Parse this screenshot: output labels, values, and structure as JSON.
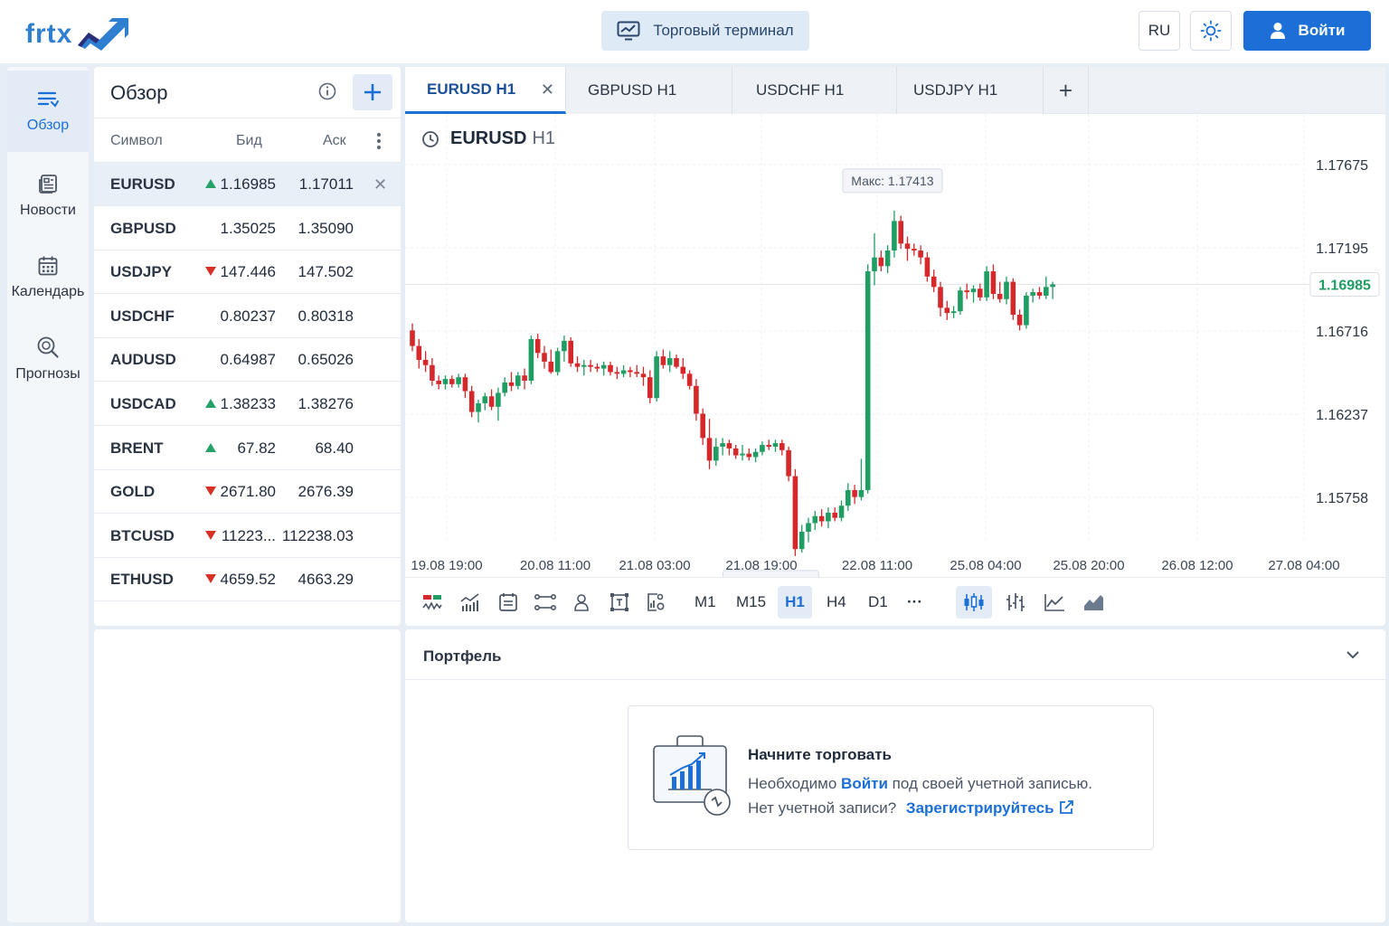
{
  "header": {
    "logo_text": "frtx",
    "terminal_label": "Торговый терминал",
    "lang": "RU",
    "login_label": "Войти",
    "brand_color": "#1b6fd6"
  },
  "nav": {
    "items": [
      {
        "label": "Обзор",
        "icon": "list-icon"
      },
      {
        "label": "Новости",
        "icon": "news-icon"
      },
      {
        "label": "Календарь",
        "icon": "calendar-icon"
      },
      {
        "label": "Прогнозы",
        "icon": "forecast-icon"
      }
    ]
  },
  "overview": {
    "title": "Обзор",
    "columns": {
      "symbol": "Символ",
      "bid": "Бид",
      "ask": "Аск"
    },
    "rows": [
      {
        "symbol": "EURUSD",
        "dir": "up",
        "bid": "1.16985",
        "ask": "1.17011"
      },
      {
        "symbol": "GBPUSD",
        "dir": "",
        "bid": "1.35025",
        "ask": "1.35090"
      },
      {
        "symbol": "USDJPY",
        "dir": "down",
        "bid": "147.446",
        "ask": "147.502"
      },
      {
        "symbol": "USDCHF",
        "dir": "",
        "bid": "0.80237",
        "ask": "0.80318"
      },
      {
        "symbol": "AUDUSD",
        "dir": "",
        "bid": "0.64987",
        "ask": "0.65026"
      },
      {
        "symbol": "USDCAD",
        "dir": "up",
        "bid": "1.38233",
        "ask": "1.38276"
      },
      {
        "symbol": "BRENT",
        "dir": "up",
        "bid": "67.82",
        "ask": "68.40"
      },
      {
        "symbol": "GOLD",
        "dir": "down",
        "bid": "2671.80",
        "ask": "2676.39"
      },
      {
        "symbol": "BTCUSD",
        "dir": "down",
        "bid": "11223...",
        "ask": "112238.03"
      },
      {
        "symbol": "ETHUSD",
        "dir": "down",
        "bid": "4659.52",
        "ask": "4663.29"
      }
    ]
  },
  "tabs": [
    {
      "label": "EURUSD H1",
      "active": true
    },
    {
      "label": "GBPUSD H1"
    },
    {
      "label": "USDCHF H1"
    },
    {
      "label": "USDJPY H1"
    }
  ],
  "chart": {
    "symbol": "EURUSD",
    "timeframe": "H1",
    "y_ticks": [
      "1.17675",
      "1.17195",
      "1.16716",
      "1.16237",
      "1.15758"
    ],
    "current_price": "1.16985",
    "max_label": "Макс: 1.17413",
    "min_label": "Мин: 1.15418",
    "x_ticks": [
      "19.08 19:00",
      "20.08 11:00",
      "21.08 03:00",
      "21.08 19:00",
      "22.08 11:00",
      "25.08 04:00",
      "25.08 20:00",
      "26.08 12:00",
      "27.08 04:00"
    ],
    "up_color": "#1f9d63",
    "down_color": "#d6282b"
  },
  "toolbar": {
    "timeframes": [
      "M1",
      "M15",
      "H1",
      "H4",
      "D1"
    ],
    "active_timeframe": "H1",
    "more": "···"
  },
  "portfolio": {
    "title": "Портфель",
    "card_title": "Начните торговать",
    "line1_prefix": "Необходимо",
    "line1_link": "Войти",
    "line1_suffix": "под своей учетной записью.",
    "line2_prefix": "Нет учетной записи?",
    "line2_link": "Зарегистрируйтесь"
  },
  "chart_data": {
    "type": "candlestick",
    "symbol": "EURUSD",
    "timeframe": "H1",
    "ylim": [
      1.156,
      1.1775
    ],
    "y_ticks": [
      1.17675,
      1.17195,
      1.16716,
      1.16237,
      1.15758
    ],
    "current": 1.16985,
    "max": 1.17413,
    "min": 1.15418,
    "candles": [
      [
        1.1672,
        1.1676,
        1.166,
        1.1663
      ],
      [
        1.1663,
        1.1667,
        1.165,
        1.1655
      ],
      [
        1.1655,
        1.166,
        1.1648,
        1.1652
      ],
      [
        1.1652,
        1.1656,
        1.164,
        1.1643
      ],
      [
        1.1643,
        1.1646,
        1.1638,
        1.1641
      ],
      [
        1.1641,
        1.1646,
        1.1638,
        1.1644
      ],
      [
        1.1644,
        1.1646,
        1.1639,
        1.1641
      ],
      [
        1.1641,
        1.1647,
        1.1639,
        1.1645
      ],
      [
        1.1645,
        1.1647,
        1.1633,
        1.1637
      ],
      [
        1.1637,
        1.164,
        1.1622,
        1.1625
      ],
      [
        1.1625,
        1.1632,
        1.1619,
        1.163
      ],
      [
        1.163,
        1.1636,
        1.1626,
        1.1634
      ],
      [
        1.1634,
        1.1638,
        1.1626,
        1.1628
      ],
      [
        1.1628,
        1.1639,
        1.162,
        1.1636
      ],
      [
        1.1636,
        1.1645,
        1.1634,
        1.1642
      ],
      [
        1.1642,
        1.1648,
        1.1637,
        1.164
      ],
      [
        1.164,
        1.1648,
        1.1638,
        1.1646
      ],
      [
        1.1646,
        1.165,
        1.1638,
        1.1643
      ],
      [
        1.1643,
        1.1669,
        1.1641,
        1.1667
      ],
      [
        1.1667,
        1.167,
        1.1656,
        1.1659
      ],
      [
        1.1659,
        1.1663,
        1.165,
        1.1654
      ],
      [
        1.1654,
        1.1661,
        1.1647,
        1.1648
      ],
      [
        1.1648,
        1.1662,
        1.1646,
        1.166
      ],
      [
        1.166,
        1.1669,
        1.1654,
        1.1666
      ],
      [
        1.1666,
        1.1668,
        1.1651,
        1.1653
      ],
      [
        1.1653,
        1.1657,
        1.1648,
        1.1651
      ],
      [
        1.1651,
        1.1655,
        1.1646,
        1.1652
      ],
      [
        1.1652,
        1.1655,
        1.1648,
        1.1651
      ],
      [
        1.1651,
        1.1653,
        1.1648,
        1.165
      ],
      [
        1.165,
        1.1654,
        1.1646,
        1.1652
      ],
      [
        1.1652,
        1.1654,
        1.1646,
        1.1648
      ],
      [
        1.1648,
        1.1651,
        1.1644,
        1.1647
      ],
      [
        1.1647,
        1.1652,
        1.1645,
        1.1649
      ],
      [
        1.1649,
        1.1651,
        1.1645,
        1.1648
      ],
      [
        1.1648,
        1.1652,
        1.1645,
        1.1647
      ],
      [
        1.1647,
        1.1651,
        1.164,
        1.1645
      ],
      [
        1.1645,
        1.1649,
        1.163,
        1.1633
      ],
      [
        1.1633,
        1.166,
        1.1631,
        1.1657
      ],
      [
        1.1657,
        1.1661,
        1.165,
        1.1652
      ],
      [
        1.1652,
        1.166,
        1.1648,
        1.1656
      ],
      [
        1.1656,
        1.1658,
        1.165,
        1.1651
      ],
      [
        1.1651,
        1.1656,
        1.1644,
        1.1647
      ],
      [
        1.1647,
        1.1649,
        1.1638,
        1.164
      ],
      [
        1.164,
        1.1644,
        1.162,
        1.1624
      ],
      [
        1.1624,
        1.1627,
        1.1606,
        1.161
      ],
      [
        1.161,
        1.1621,
        1.1592,
        1.1597
      ],
      [
        1.1597,
        1.161,
        1.1594,
        1.1605
      ],
      [
        1.1605,
        1.161,
        1.16,
        1.1607
      ],
      [
        1.1607,
        1.1609,
        1.16,
        1.1604
      ],
      [
        1.1604,
        1.1606,
        1.1598,
        1.16
      ],
      [
        1.16,
        1.1606,
        1.1597,
        1.1601
      ],
      [
        1.1601,
        1.1604,
        1.1597,
        1.1599
      ],
      [
        1.1599,
        1.1604,
        1.1596,
        1.1602
      ],
      [
        1.1602,
        1.1608,
        1.16,
        1.1606
      ],
      [
        1.1606,
        1.1609,
        1.1603,
        1.1605
      ],
      [
        1.1605,
        1.1609,
        1.1602,
        1.1607
      ],
      [
        1.1607,
        1.1609,
        1.16,
        1.1603
      ],
      [
        1.1603,
        1.1605,
        1.1585,
        1.1588
      ],
      [
        1.1588,
        1.1592,
        1.1542,
        1.1546
      ],
      [
        1.1546,
        1.156,
        1.1544,
        1.1556
      ],
      [
        1.1556,
        1.1564,
        1.155,
        1.1561
      ],
      [
        1.1561,
        1.1568,
        1.1557,
        1.1565
      ],
      [
        1.1565,
        1.1569,
        1.1559,
        1.1562
      ],
      [
        1.1562,
        1.157,
        1.1558,
        1.1567
      ],
      [
        1.1567,
        1.157,
        1.1562,
        1.1564
      ],
      [
        1.1564,
        1.1574,
        1.1562,
        1.1571
      ],
      [
        1.1571,
        1.1584,
        1.1568,
        1.158
      ],
      [
        1.158,
        1.1583,
        1.1572,
        1.1576
      ],
      [
        1.1576,
        1.1598,
        1.1574,
        1.158
      ],
      [
        1.158,
        1.171,
        1.1578,
        1.1706
      ],
      [
        1.1706,
        1.1728,
        1.1698,
        1.1714
      ],
      [
        1.1714,
        1.1718,
        1.1706,
        1.1709
      ],
      [
        1.1709,
        1.1721,
        1.1705,
        1.1718
      ],
      [
        1.1718,
        1.1741,
        1.1714,
        1.1735
      ],
      [
        1.1735,
        1.1738,
        1.1719,
        1.1722
      ],
      [
        1.1722,
        1.1726,
        1.1712,
        1.1719
      ],
      [
        1.1719,
        1.1722,
        1.1715,
        1.1718
      ],
      [
        1.1718,
        1.1721,
        1.171,
        1.1714
      ],
      [
        1.1714,
        1.1717,
        1.17,
        1.1703
      ],
      [
        1.1703,
        1.1707,
        1.1694,
        1.1697
      ],
      [
        1.1697,
        1.17,
        1.168,
        1.1685
      ],
      [
        1.1685,
        1.1689,
        1.1678,
        1.1682
      ],
      [
        1.1682,
        1.1686,
        1.1679,
        1.1683
      ],
      [
        1.1683,
        1.1697,
        1.1681,
        1.1695
      ],
      [
        1.1695,
        1.1699,
        1.169,
        1.1694
      ],
      [
        1.1694,
        1.1698,
        1.1688,
        1.1696
      ],
      [
        1.1696,
        1.1699,
        1.1689,
        1.1691
      ],
      [
        1.1691,
        1.1709,
        1.1689,
        1.1706
      ],
      [
        1.1706,
        1.171,
        1.169,
        1.1693
      ],
      [
        1.1693,
        1.17,
        1.1688,
        1.169
      ],
      [
        1.169,
        1.1703,
        1.1687,
        1.17
      ],
      [
        1.17,
        1.1702,
        1.1678,
        1.1681
      ],
      [
        1.1681,
        1.1684,
        1.1672,
        1.1675
      ],
      [
        1.1675,
        1.1694,
        1.1673,
        1.1692
      ],
      [
        1.1692,
        1.1696,
        1.1688,
        1.1694
      ],
      [
        1.1694,
        1.1697,
        1.169,
        1.1692
      ],
      [
        1.1692,
        1.1703,
        1.169,
        1.1697
      ],
      [
        1.1697,
        1.17,
        1.169,
        1.16985
      ]
    ]
  }
}
